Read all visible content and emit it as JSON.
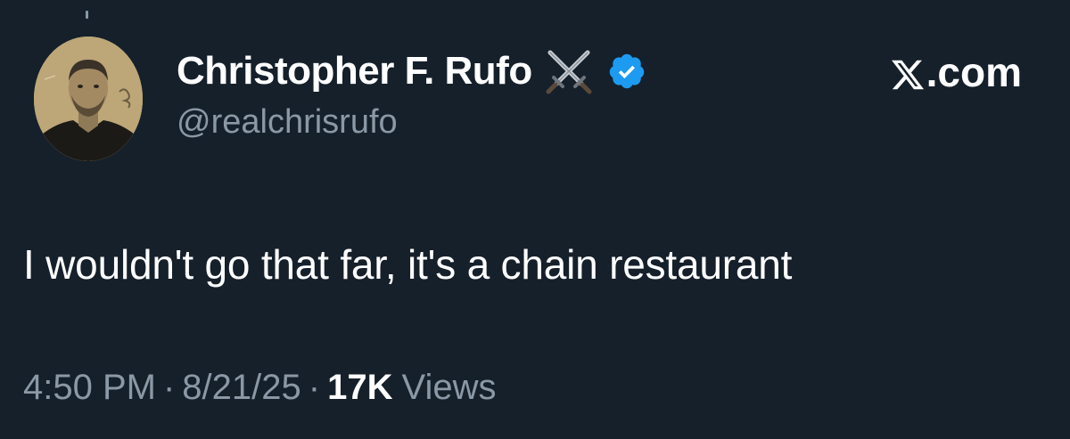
{
  "tweet": {
    "author": {
      "display_name": "Christopher F. Rufo",
      "handle": "@realchrisrufo",
      "name_emoji_icon": "crossed-swords-icon",
      "verified_icon": "verified-badge-icon"
    },
    "brand": {
      "text": ".com",
      "logo_icon": "x-logo-icon"
    },
    "text": "I wouldn't go that far, it's a chain restaurant",
    "meta": {
      "time": "4:50 PM",
      "separator": "·",
      "date": "8/21/25",
      "views_count": "17K",
      "views_label": "Views"
    }
  },
  "colors": {
    "background": "#15202b",
    "primary_text": "#ffffff",
    "secondary_text": "#8b98a5",
    "verified_blue": "#1d9bf0"
  }
}
